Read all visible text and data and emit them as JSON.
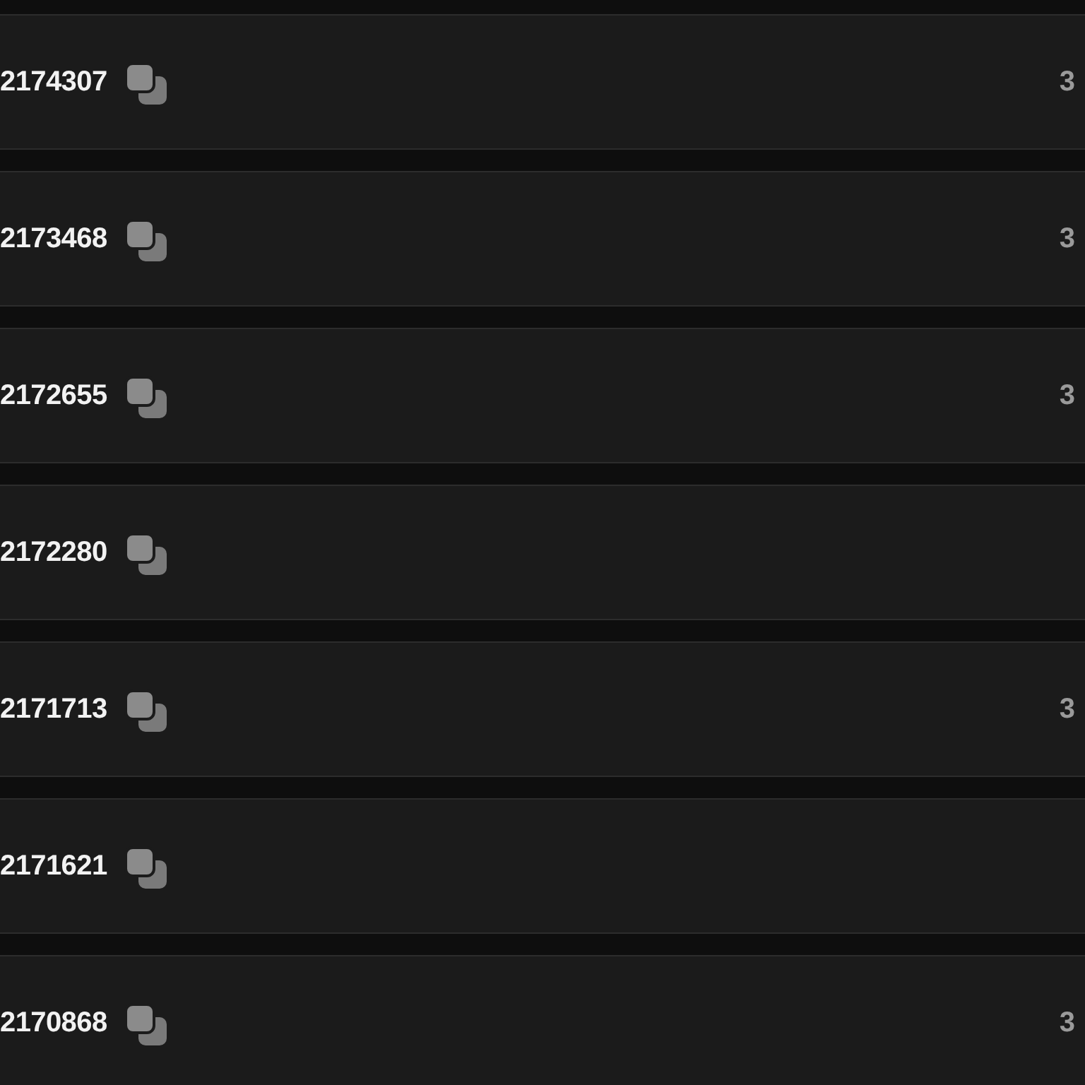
{
  "rows": [
    {
      "number": "2174307",
      "count": "3"
    },
    {
      "number": "2173468",
      "count": "3"
    },
    {
      "number": "2172655",
      "count": "3"
    },
    {
      "number": "2172280"
    },
    {
      "number": "2171713",
      "count": "3"
    },
    {
      "number": "2171621"
    },
    {
      "number": "2170868",
      "count": "3"
    }
  ]
}
